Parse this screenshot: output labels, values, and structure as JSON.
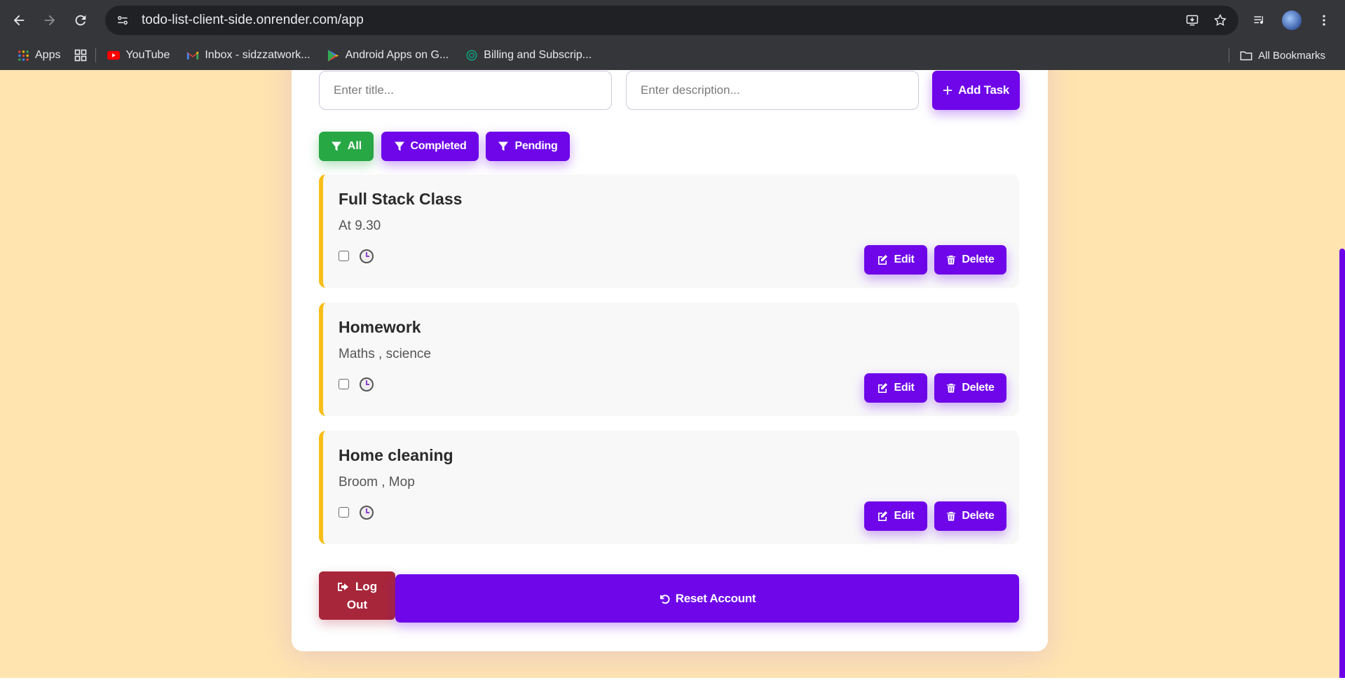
{
  "browser": {
    "url": "todo-list-client-side.onrender.com/app",
    "bookmarks": [
      {
        "label": "Apps",
        "icon": "apps-grid-icon"
      },
      {
        "label": "YouTube",
        "icon": "youtube-icon"
      },
      {
        "label": "Inbox - sidzzatwork...",
        "icon": "gmail-icon"
      },
      {
        "label": "Android Apps on G...",
        "icon": "google-play-icon"
      },
      {
        "label": "Billing and Subscrip...",
        "icon": "openai-icon"
      }
    ],
    "all_bookmarks_label": "All Bookmarks"
  },
  "form": {
    "title_placeholder": "Enter title...",
    "description_placeholder": "Enter description...",
    "add_label": "Add Task"
  },
  "filters": {
    "all": "All",
    "completed": "Completed",
    "pending": "Pending",
    "active": "All"
  },
  "tasks": [
    {
      "title": "Full Stack Class",
      "description": "At 9.30",
      "completed": false
    },
    {
      "title": "Homework",
      "description": "Maths , science",
      "completed": false
    },
    {
      "title": "Home cleaning",
      "description": "Broom , Mop",
      "completed": false
    }
  ],
  "task_actions": {
    "edit": "Edit",
    "delete": "Delete"
  },
  "footer": {
    "logout_line1": "Log",
    "logout_line2": "Out",
    "reset_label": "Reset Account"
  },
  "colors": {
    "primary": "#6e06e9",
    "active_filter": "#28a745",
    "logout": "#a8263a",
    "task_accent": "#f7be1a",
    "page_bg": "#ffe4b0"
  }
}
